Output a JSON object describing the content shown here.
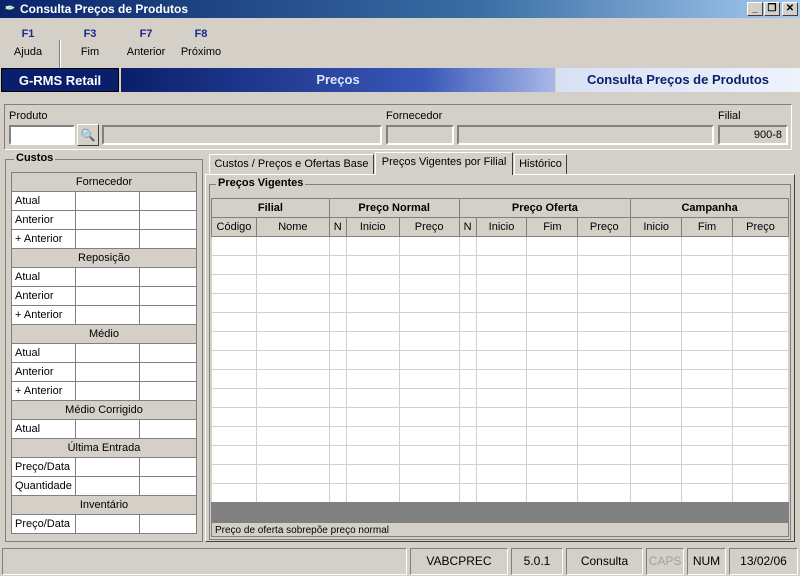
{
  "window": {
    "title": "Consulta Preços de Produtos"
  },
  "function_keys": [
    {
      "key": "F1",
      "label": "Ajuda"
    },
    {
      "key": "F3",
      "label": "Fim"
    },
    {
      "key": "F7",
      "label": "Anterior"
    },
    {
      "key": "F8",
      "label": "Próximo"
    }
  ],
  "banner": {
    "app": "G-RMS Retail",
    "module": "Preços",
    "screen": "Consulta Preços de Produtos"
  },
  "header": {
    "produto_label": "Produto",
    "produto_value": "",
    "fornecedor_label": "Fornecedor",
    "filial_label": "Filial",
    "filial_value": "900-8"
  },
  "costs": {
    "title": "Custos",
    "sections": {
      "fornecedor": "Fornecedor",
      "reposicao": "Reposição",
      "medio": "Médio",
      "medio_corrigido": "Médio Corrigido",
      "ultima_entrada": "Última Entrada",
      "inventario": "Inventário"
    },
    "rows": {
      "atual": "Atual",
      "anterior": "Anterior",
      "mais_anterior": "+ Anterior",
      "preco_data": "Preço/Data",
      "quantidade": "Quantidade"
    }
  },
  "tabs": [
    {
      "label": "Custos / Preços e Ofertas Base"
    },
    {
      "label": "Preços Vigentes por Filial",
      "active": true
    },
    {
      "label": "Histórico"
    }
  ],
  "grid": {
    "title": "Preços Vigentes",
    "groups": {
      "filial": "Filial",
      "preco_normal": "Preço Normal",
      "preco_oferta": "Preço Oferta",
      "campanha": "Campanha"
    },
    "columns": {
      "codigo": "Código",
      "nome": "Nome",
      "n": "N",
      "inicio": "Inicio",
      "preco": "Preço",
      "fim": "Fim"
    },
    "note": "Preço de oferta sobrepõe preço normal"
  },
  "status": {
    "program": "VABCPREC",
    "version": "5.0.1",
    "mode": "Consulta",
    "caps": "CAPS",
    "num": "NUM",
    "date": "13/02/06"
  }
}
